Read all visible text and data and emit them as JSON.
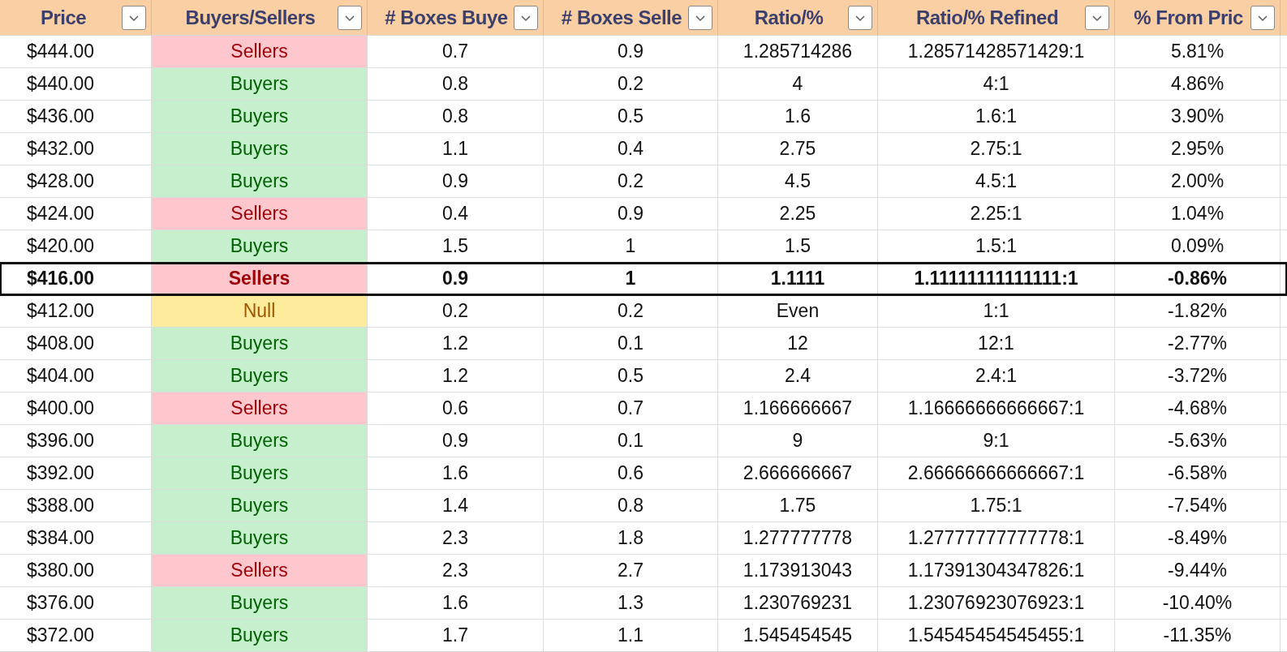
{
  "columns": [
    {
      "label": "Price"
    },
    {
      "label": "Buyers/Sellers"
    },
    {
      "label": "# Boxes Buye"
    },
    {
      "label": "# Boxes Selle"
    },
    {
      "label": "Ratio/%"
    },
    {
      "label": "Ratio/% Refined"
    },
    {
      "label": "% From Pric"
    }
  ],
  "rows": [
    {
      "price": "$444.00",
      "side": "Sellers",
      "kind": "sellers",
      "buyers": "0.7",
      "sellers": "0.9",
      "ratio": "1.285714286",
      "refined": "1.28571428571429:1",
      "from": "5.81%",
      "selected": false
    },
    {
      "price": "$440.00",
      "side": "Buyers",
      "kind": "buyers",
      "buyers": "0.8",
      "sellers": "0.2",
      "ratio": "4",
      "refined": "4:1",
      "from": "4.86%",
      "selected": false
    },
    {
      "price": "$436.00",
      "side": "Buyers",
      "kind": "buyers",
      "buyers": "0.8",
      "sellers": "0.5",
      "ratio": "1.6",
      "refined": "1.6:1",
      "from": "3.90%",
      "selected": false
    },
    {
      "price": "$432.00",
      "side": "Buyers",
      "kind": "buyers",
      "buyers": "1.1",
      "sellers": "0.4",
      "ratio": "2.75",
      "refined": "2.75:1",
      "from": "2.95%",
      "selected": false
    },
    {
      "price": "$428.00",
      "side": "Buyers",
      "kind": "buyers",
      "buyers": "0.9",
      "sellers": "0.2",
      "ratio": "4.5",
      "refined": "4.5:1",
      "from": "2.00%",
      "selected": false
    },
    {
      "price": "$424.00",
      "side": "Sellers",
      "kind": "sellers",
      "buyers": "0.4",
      "sellers": "0.9",
      "ratio": "2.25",
      "refined": "2.25:1",
      "from": "1.04%",
      "selected": false
    },
    {
      "price": "$420.00",
      "side": "Buyers",
      "kind": "buyers",
      "buyers": "1.5",
      "sellers": "1",
      "ratio": "1.5",
      "refined": "1.5:1",
      "from": "0.09%",
      "selected": false
    },
    {
      "price": "$416.00",
      "side": "Sellers",
      "kind": "sellers",
      "buyers": "0.9",
      "sellers": "1",
      "ratio": "1.1111",
      "refined": "1.11111111111111:1",
      "from": "-0.86%",
      "selected": true
    },
    {
      "price": "$412.00",
      "side": "Null",
      "kind": "null",
      "buyers": "0.2",
      "sellers": "0.2",
      "ratio": "Even",
      "refined": "1:1",
      "from": "-1.82%",
      "selected": false
    },
    {
      "price": "$408.00",
      "side": "Buyers",
      "kind": "buyers",
      "buyers": "1.2",
      "sellers": "0.1",
      "ratio": "12",
      "refined": "12:1",
      "from": "-2.77%",
      "selected": false
    },
    {
      "price": "$404.00",
      "side": "Buyers",
      "kind": "buyers",
      "buyers": "1.2",
      "sellers": "0.5",
      "ratio": "2.4",
      "refined": "2.4:1",
      "from": "-3.72%",
      "selected": false
    },
    {
      "price": "$400.00",
      "side": "Sellers",
      "kind": "sellers",
      "buyers": "0.6",
      "sellers": "0.7",
      "ratio": "1.166666667",
      "refined": "1.16666666666667:1",
      "from": "-4.68%",
      "selected": false
    },
    {
      "price": "$396.00",
      "side": "Buyers",
      "kind": "buyers",
      "buyers": "0.9",
      "sellers": "0.1",
      "ratio": "9",
      "refined": "9:1",
      "from": "-5.63%",
      "selected": false
    },
    {
      "price": "$392.00",
      "side": "Buyers",
      "kind": "buyers",
      "buyers": "1.6",
      "sellers": "0.6",
      "ratio": "2.666666667",
      "refined": "2.66666666666667:1",
      "from": "-6.58%",
      "selected": false
    },
    {
      "price": "$388.00",
      "side": "Buyers",
      "kind": "buyers",
      "buyers": "1.4",
      "sellers": "0.8",
      "ratio": "1.75",
      "refined": "1.75:1",
      "from": "-7.54%",
      "selected": false
    },
    {
      "price": "$384.00",
      "side": "Buyers",
      "kind": "buyers",
      "buyers": "2.3",
      "sellers": "1.8",
      "ratio": "1.277777778",
      "refined": "1.27777777777778:1",
      "from": "-8.49%",
      "selected": false
    },
    {
      "price": "$380.00",
      "side": "Sellers",
      "kind": "sellers",
      "buyers": "2.3",
      "sellers": "2.7",
      "ratio": "1.173913043",
      "refined": "1.17391304347826:1",
      "from": "-9.44%",
      "selected": false
    },
    {
      "price": "$376.00",
      "side": "Buyers",
      "kind": "buyers",
      "buyers": "1.6",
      "sellers": "1.3",
      "ratio": "1.230769231",
      "refined": "1.23076923076923:1",
      "from": "-10.40%",
      "selected": false
    },
    {
      "price": "$372.00",
      "side": "Buyers",
      "kind": "buyers",
      "buyers": "1.7",
      "sellers": "1.1",
      "ratio": "1.545454545",
      "refined": "1.54545454545455:1",
      "from": "-11.35%",
      "selected": false
    }
  ]
}
